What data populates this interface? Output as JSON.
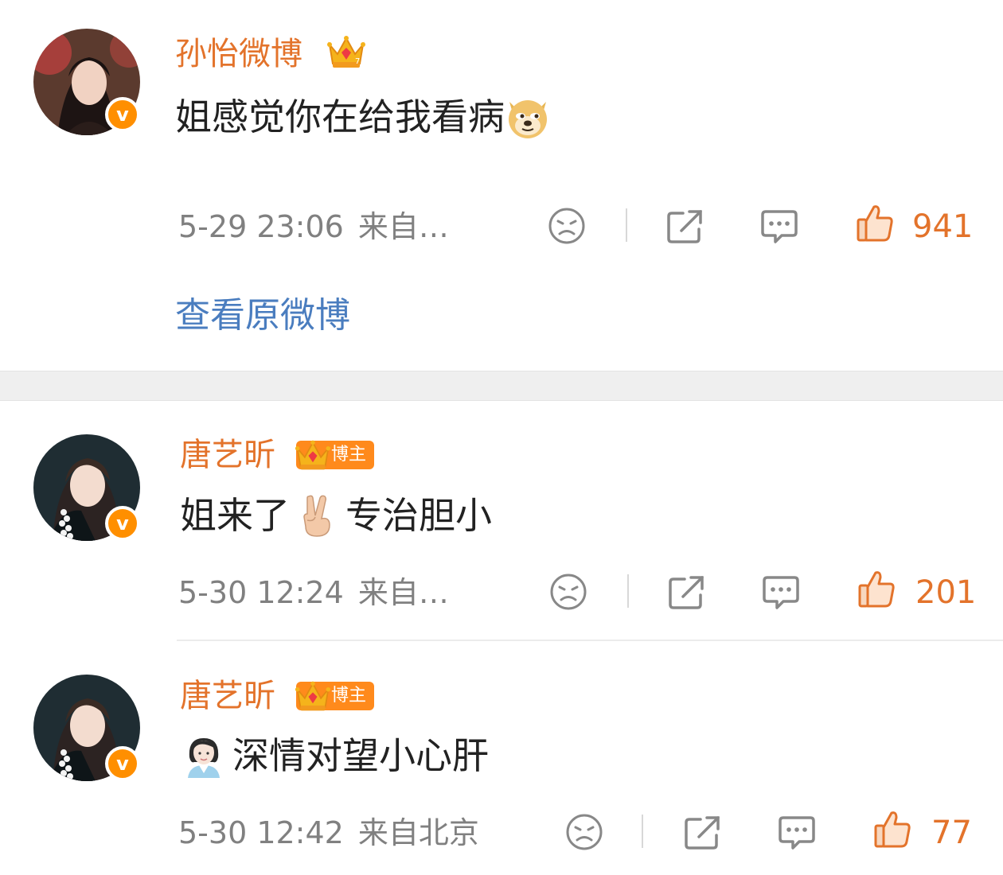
{
  "comments": [
    {
      "username": "孙怡微博",
      "text": "姐感觉你在给我看病",
      "emoji": "doge-emoji",
      "time": "5-29 23:06",
      "source": "来自…",
      "likes": "941",
      "badge": ""
    },
    {
      "username": "唐艺昕",
      "badge": "博主",
      "text_before": "姐来了",
      "emoji": "victory-hand-emoji",
      "text_after": "专治胆小",
      "time": "5-30 12:24",
      "source": "来自…",
      "likes": "201"
    },
    {
      "username": "唐艺昕",
      "badge": "博主",
      "emoji": "woman-office-worker-emoji",
      "text": "深情对望小心肝",
      "time": "5-30 12:42",
      "source": "来自北京",
      "likes": "77"
    }
  ],
  "view_original_label": "查看原微博",
  "verified_badge_letter": "v",
  "colors": {
    "username": "#e3732b",
    "like": "#e3732b",
    "link": "#4a7dbf",
    "meta": "#808080",
    "verified": "#ff8f00"
  }
}
